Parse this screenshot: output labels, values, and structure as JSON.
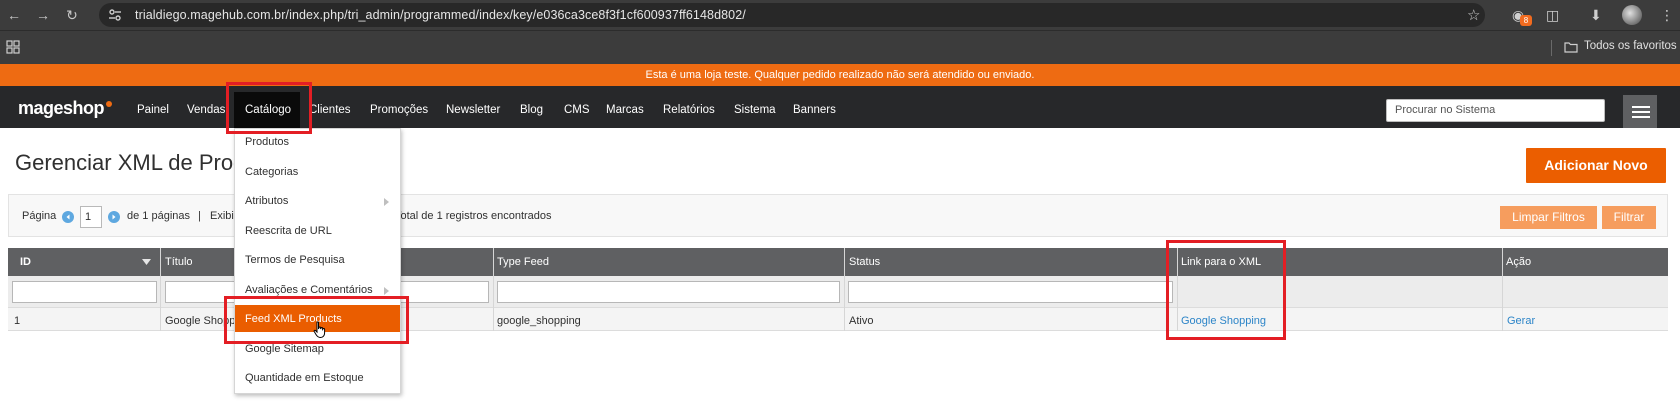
{
  "browser": {
    "url": "trialdiego.magehub.com.br/index.php/tri_admin/programmed/index/key/e036ca3ce8f3f1cf600937ff6148d802/",
    "extension_badge": "8",
    "bookmarks_folder": "Todos os favoritos",
    "icons": [
      "back-icon",
      "forward-icon",
      "reload-icon",
      "site-info-icon",
      "star-icon",
      "extension-icon",
      "puzzle-icon",
      "download-icon",
      "profile-avatar",
      "kebab-menu-icon",
      "apps-grid-icon",
      "folder-icon"
    ]
  },
  "banner": {
    "text": "Esta é uma loja teste. Qualquer pedido realizado não será atendido ou enviado."
  },
  "admin": {
    "logo": "mageshop",
    "accent": "#ee6b12",
    "nav": [
      {
        "label": "Painel"
      },
      {
        "label": "Vendas"
      },
      {
        "label": "Catálogo"
      },
      {
        "label": "Clientes"
      },
      {
        "label": "Promoções"
      },
      {
        "label": "Newsletter"
      },
      {
        "label": "Blog"
      },
      {
        "label": "CMS"
      },
      {
        "label": "Marcas"
      },
      {
        "label": "Relatórios"
      },
      {
        "label": "Sistema"
      },
      {
        "label": "Banners"
      }
    ],
    "search_placeholder": "Procurar no Sistema"
  },
  "catalog_menu": {
    "items": [
      {
        "label": "Produtos"
      },
      {
        "label": "Categorias"
      },
      {
        "label": "Atributos"
      },
      {
        "label": "Reescrita de URL"
      },
      {
        "label": "Termos de Pesquisa"
      },
      {
        "label": "Avaliações e Comentários"
      },
      {
        "label": "Feed XML Products"
      },
      {
        "label": "Google Sitemap"
      },
      {
        "label": "Quantidade em Estoque"
      }
    ]
  },
  "page": {
    "title": "Gerenciar XML de Produtos",
    "add_new": "Adicionar Novo"
  },
  "pager": {
    "page_label": "Página",
    "page_value": "1",
    "of_pages": "de 1 páginas",
    "sep": "|",
    "show_label": "Exibir",
    "records": "Total de 1 registros encontrados",
    "clear_filters": "Limpar Filtros",
    "filter": "Filtrar"
  },
  "grid": {
    "columns": [
      "ID",
      "Título",
      "Type Feed",
      "Status",
      "Link para o XML",
      "Ação"
    ],
    "rows": [
      {
        "id": "1",
        "title": "Google Shopping",
        "type_feed": "google_shopping",
        "status": "Ativo",
        "link": "Google Shopping",
        "action": "Gerar"
      }
    ]
  }
}
